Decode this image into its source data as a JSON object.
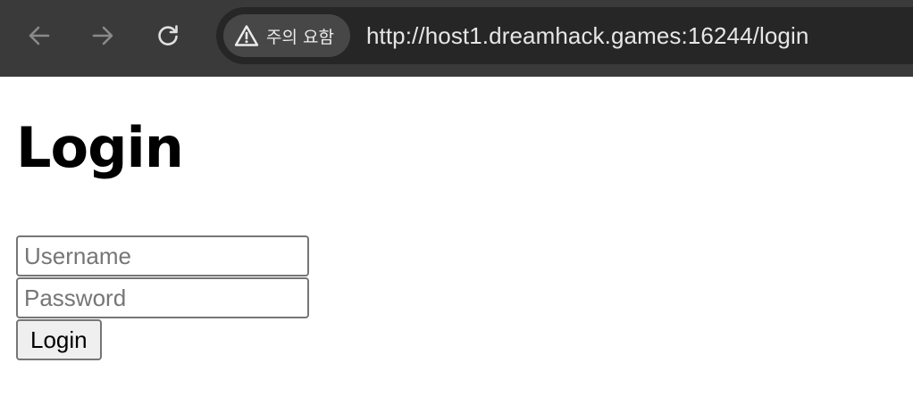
{
  "browser": {
    "nav": {
      "back_icon": "arrow-left-icon",
      "forward_icon": "arrow-right-icon",
      "reload_icon": "reload-icon"
    },
    "security_chip": {
      "icon": "warning-triangle-icon",
      "label": "주의 요함"
    },
    "url": "http://host1.dreamhack.games:16244/login",
    "colors": {
      "toolbar_bg": "#3a3a3a",
      "omnibox_bg": "#262626",
      "chip_bg": "#474747"
    }
  },
  "page": {
    "title": "Login",
    "form": {
      "username_placeholder": "Username",
      "password_placeholder": "Password",
      "submit_label": "Login"
    }
  }
}
